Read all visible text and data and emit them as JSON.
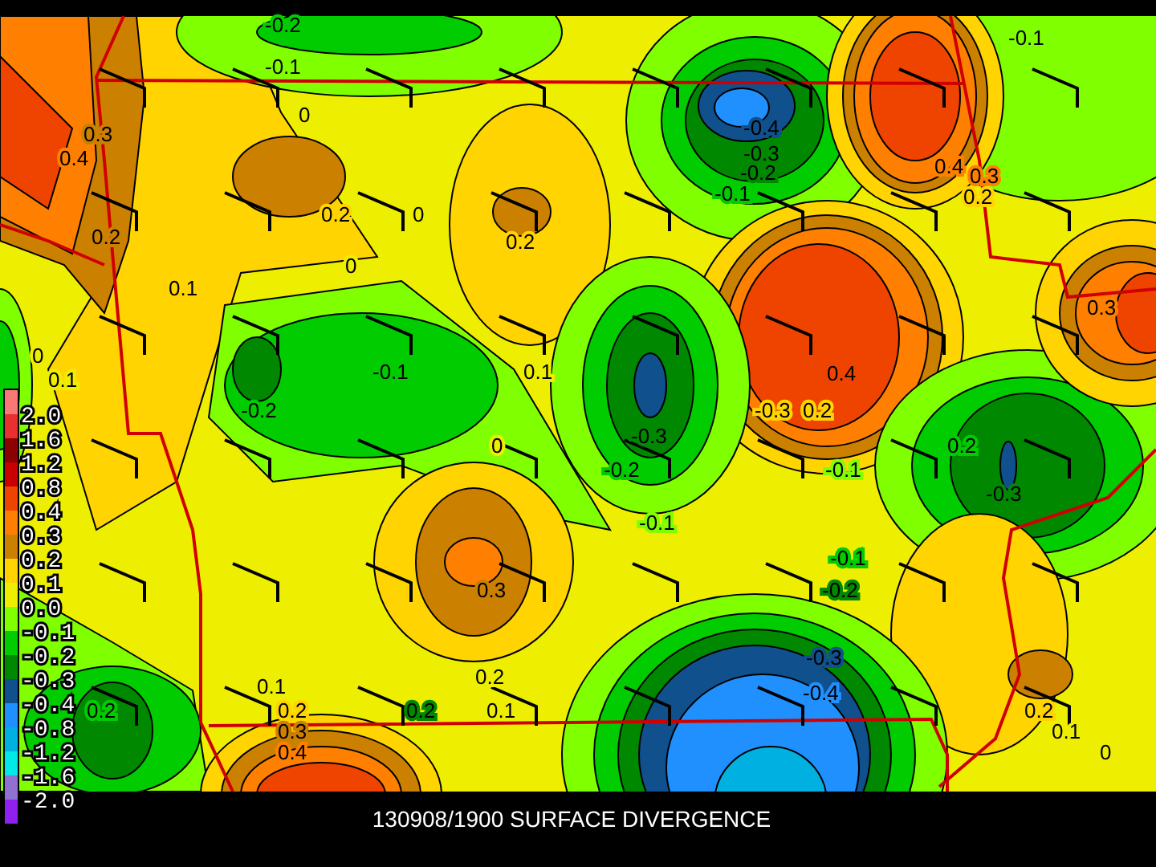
{
  "map": {
    "contour_labels": [
      "-0.2",
      "-0.1",
      "-0.1",
      "0",
      "-0.4",
      "0.3",
      "-0.3",
      "0.4",
      "-0.2",
      "0.4",
      "0.3",
      "-0.1",
      "0.2",
      "0.2",
      "0",
      "0.2",
      "0.2",
      "0",
      "0.1",
      "0.3",
      "-0.1",
      "0.1",
      "0",
      "0.4",
      "0.1",
      "-0.2",
      "-0.3",
      "0.2",
      "-0.3",
      "0",
      "0.2",
      "-0.2",
      "-0.1",
      "-0.3",
      "-0.1",
      "-0.1",
      "0.3",
      "-0.2",
      "-0.3",
      "-0.4",
      "0.2",
      "0.1",
      "0.2",
      "0.2",
      "0.2",
      "0.1",
      "0.2",
      "0.3",
      "0.1",
      "0.4",
      "0"
    ]
  },
  "legend": {
    "swatches": [
      {
        "color": "#f87878"
      },
      {
        "color": "#e83030"
      },
      {
        "color": "#8b0000"
      },
      {
        "color": "#c80000"
      },
      {
        "color": "#ee4400"
      },
      {
        "color": "#ff8000"
      },
      {
        "color": "#cc8000"
      },
      {
        "color": "#ffd400"
      },
      {
        "color": "#eeee00"
      },
      {
        "color": "#80ff00"
      },
      {
        "color": "#00cc00"
      },
      {
        "color": "#008800"
      },
      {
        "color": "#10508c"
      },
      {
        "color": "#2090ff"
      },
      {
        "color": "#00b0e0"
      },
      {
        "color": "#00e8e8"
      },
      {
        "color": "#9070d0"
      },
      {
        "color": "#9020f0"
      }
    ],
    "labels": [
      "2.0",
      "1.6",
      "1.2",
      "0.8",
      "0.4",
      "0.3",
      "0.2",
      "0.1",
      "0.0",
      "-0.1",
      "-0.2",
      "-0.3",
      "-0.4",
      "-0.8",
      "-1.2",
      "-1.6",
      "-2.0"
    ]
  },
  "title": "130908/1900 SURFACE DIVERGENCE"
}
